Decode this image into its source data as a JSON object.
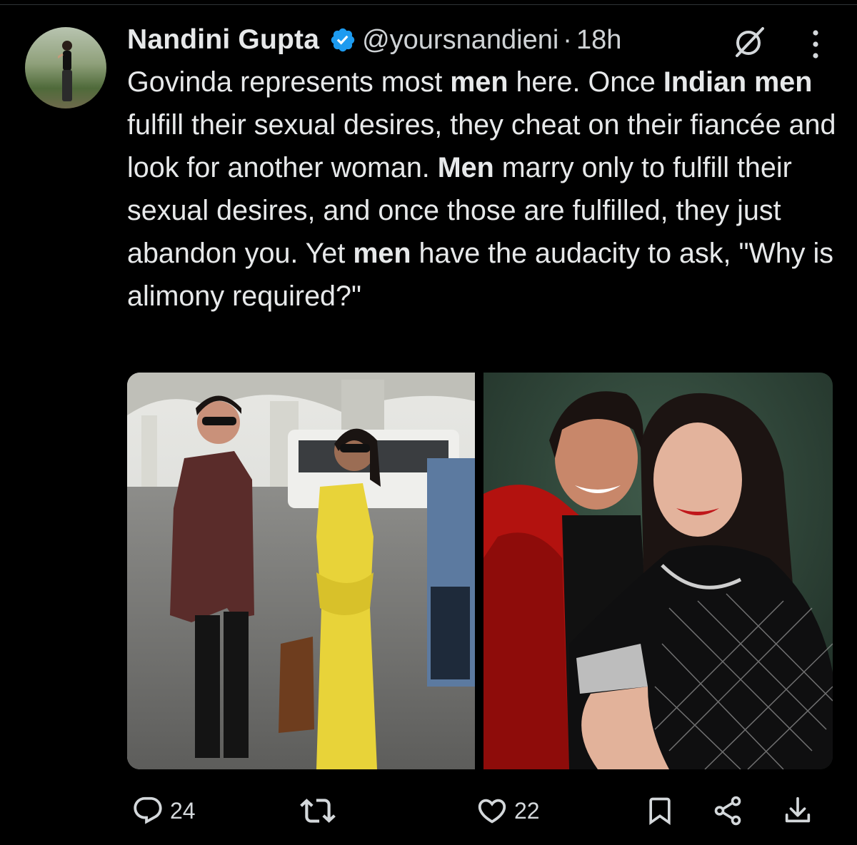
{
  "tweet": {
    "author_name": "Nandini Gupta",
    "handle": "@yoursnandieni",
    "separator": "·",
    "time": "18h",
    "text_segments": [
      {
        "t": "Govinda represents most ",
        "b": false
      },
      {
        "t": "men",
        "b": true
      },
      {
        "t": " here. Once ",
        "b": false
      },
      {
        "t": "Indian men",
        "b": true
      },
      {
        "t": " fulfill their sexual desires, they cheat on their fiancée and look for another woman. ",
        "b": false
      },
      {
        "t": "Men",
        "b": true
      },
      {
        "t": " marry only to fulfill their sexual desires, and once those are fulfilled, they just abandon you. Yet ",
        "b": false
      },
      {
        "t": "men",
        "b": true
      },
      {
        "t": " have the audacity to ask, \"Why is alimony required?\"",
        "b": false
      }
    ]
  },
  "actions": {
    "replies": "24",
    "reposts": "",
    "likes": "22"
  },
  "colors": {
    "background": "#000000",
    "text": "#e7e9ea",
    "secondary": "#cfd3d6",
    "verified_blue": "#1d9bf0"
  }
}
